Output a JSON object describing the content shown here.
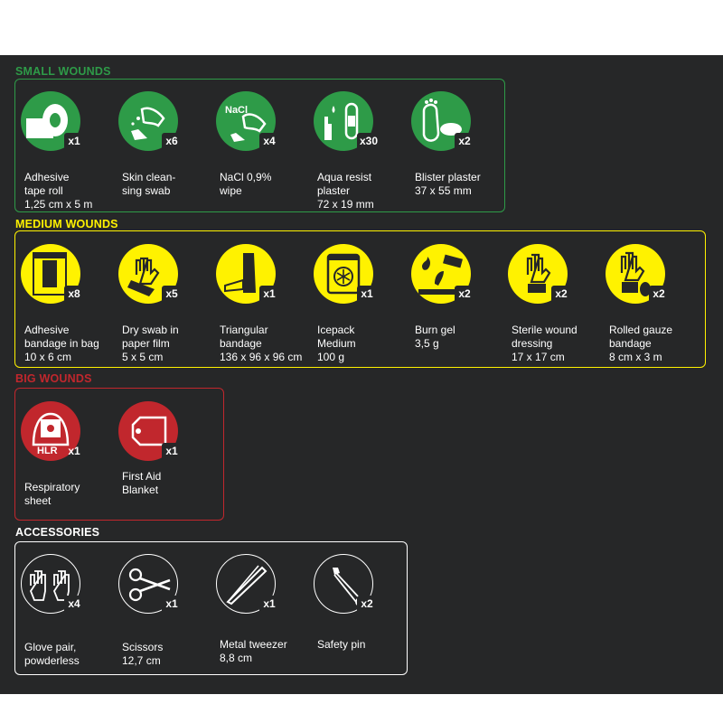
{
  "colors": {
    "background": "#262728",
    "green": "#2e9b48",
    "yellow": "#fff200",
    "red": "#c1272d",
    "white": "#ffffff"
  },
  "sections": {
    "small": {
      "title": "SMALL WOUNDS",
      "items": [
        {
          "icon": "tape-roll-icon",
          "qty": "x1",
          "lines": [
            "Adhesive",
            "tape roll",
            "1,25 cm x 5 m"
          ]
        },
        {
          "icon": "cleansing-swab-icon",
          "qty": "x6",
          "lines": [
            "Skin clean-",
            "sing swab"
          ]
        },
        {
          "icon": "nacl-wipe-icon",
          "icon_text": "NaCl",
          "qty": "x4",
          "lines": [
            "NaCl 0,9%",
            "wipe"
          ]
        },
        {
          "icon": "aqua-plaster-icon",
          "qty": "x30",
          "lines": [
            "Aqua resist",
            "plaster",
            "72 x 19 mm"
          ]
        },
        {
          "icon": "blister-plaster-icon",
          "qty": "x2",
          "lines": [
            "Blister plaster",
            "37 x 55 mm"
          ]
        }
      ]
    },
    "medium": {
      "title": "MEDIUM WOUNDS",
      "items": [
        {
          "icon": "adhesive-bandage-icon",
          "qty": "x8",
          "lines": [
            "Adhesive",
            "bandage in bag",
            "10 x 6 cm"
          ]
        },
        {
          "icon": "dry-swab-icon",
          "qty": "x5",
          "lines": [
            "Dry swab in",
            "paper film",
            "5 x 5 cm"
          ]
        },
        {
          "icon": "triangular-bandage-icon",
          "qty": "x1",
          "lines": [
            "Triangular",
            "bandage",
            "136 x 96 x 96 cm"
          ]
        },
        {
          "icon": "icepack-icon",
          "qty": "x1",
          "lines": [
            "Icepack",
            "Medium",
            "100 g"
          ]
        },
        {
          "icon": "burn-gel-icon",
          "qty": "x2",
          "lines": [
            "Burn gel",
            "3,5 g"
          ]
        },
        {
          "icon": "wound-dressing-icon",
          "qty": "x2",
          "lines": [
            "Sterile wound",
            "dressing",
            "17 x 17 cm"
          ]
        },
        {
          "icon": "gauze-bandage-icon",
          "qty": "x2",
          "lines": [
            "Rolled gauze",
            "bandage",
            "8 cm x 3 m"
          ]
        }
      ]
    },
    "big": {
      "title": "BIG WOUNDS",
      "items": [
        {
          "icon": "respiratory-sheet-icon",
          "icon_text": "HLR",
          "qty": "x1",
          "lines": [
            "Respiratory",
            "sheet"
          ]
        },
        {
          "icon": "first-aid-blanket-icon",
          "qty": "x1",
          "lines": [
            "First Aid",
            "Blanket"
          ]
        }
      ]
    },
    "accessories": {
      "title": "ACCESSORIES",
      "items": [
        {
          "icon": "gloves-icon",
          "qty": "x4",
          "lines": [
            "Glove pair,",
            "powderless"
          ]
        },
        {
          "icon": "scissors-icon",
          "qty": "x1",
          "lines": [
            "Scissors",
            "12,7 cm"
          ]
        },
        {
          "icon": "tweezer-icon",
          "qty": "x1",
          "lines": [
            "Metal tweezer",
            "8,8 cm"
          ]
        },
        {
          "icon": "safety-pin-icon",
          "qty": "x2",
          "lines": [
            "Safety pin"
          ]
        }
      ]
    }
  }
}
